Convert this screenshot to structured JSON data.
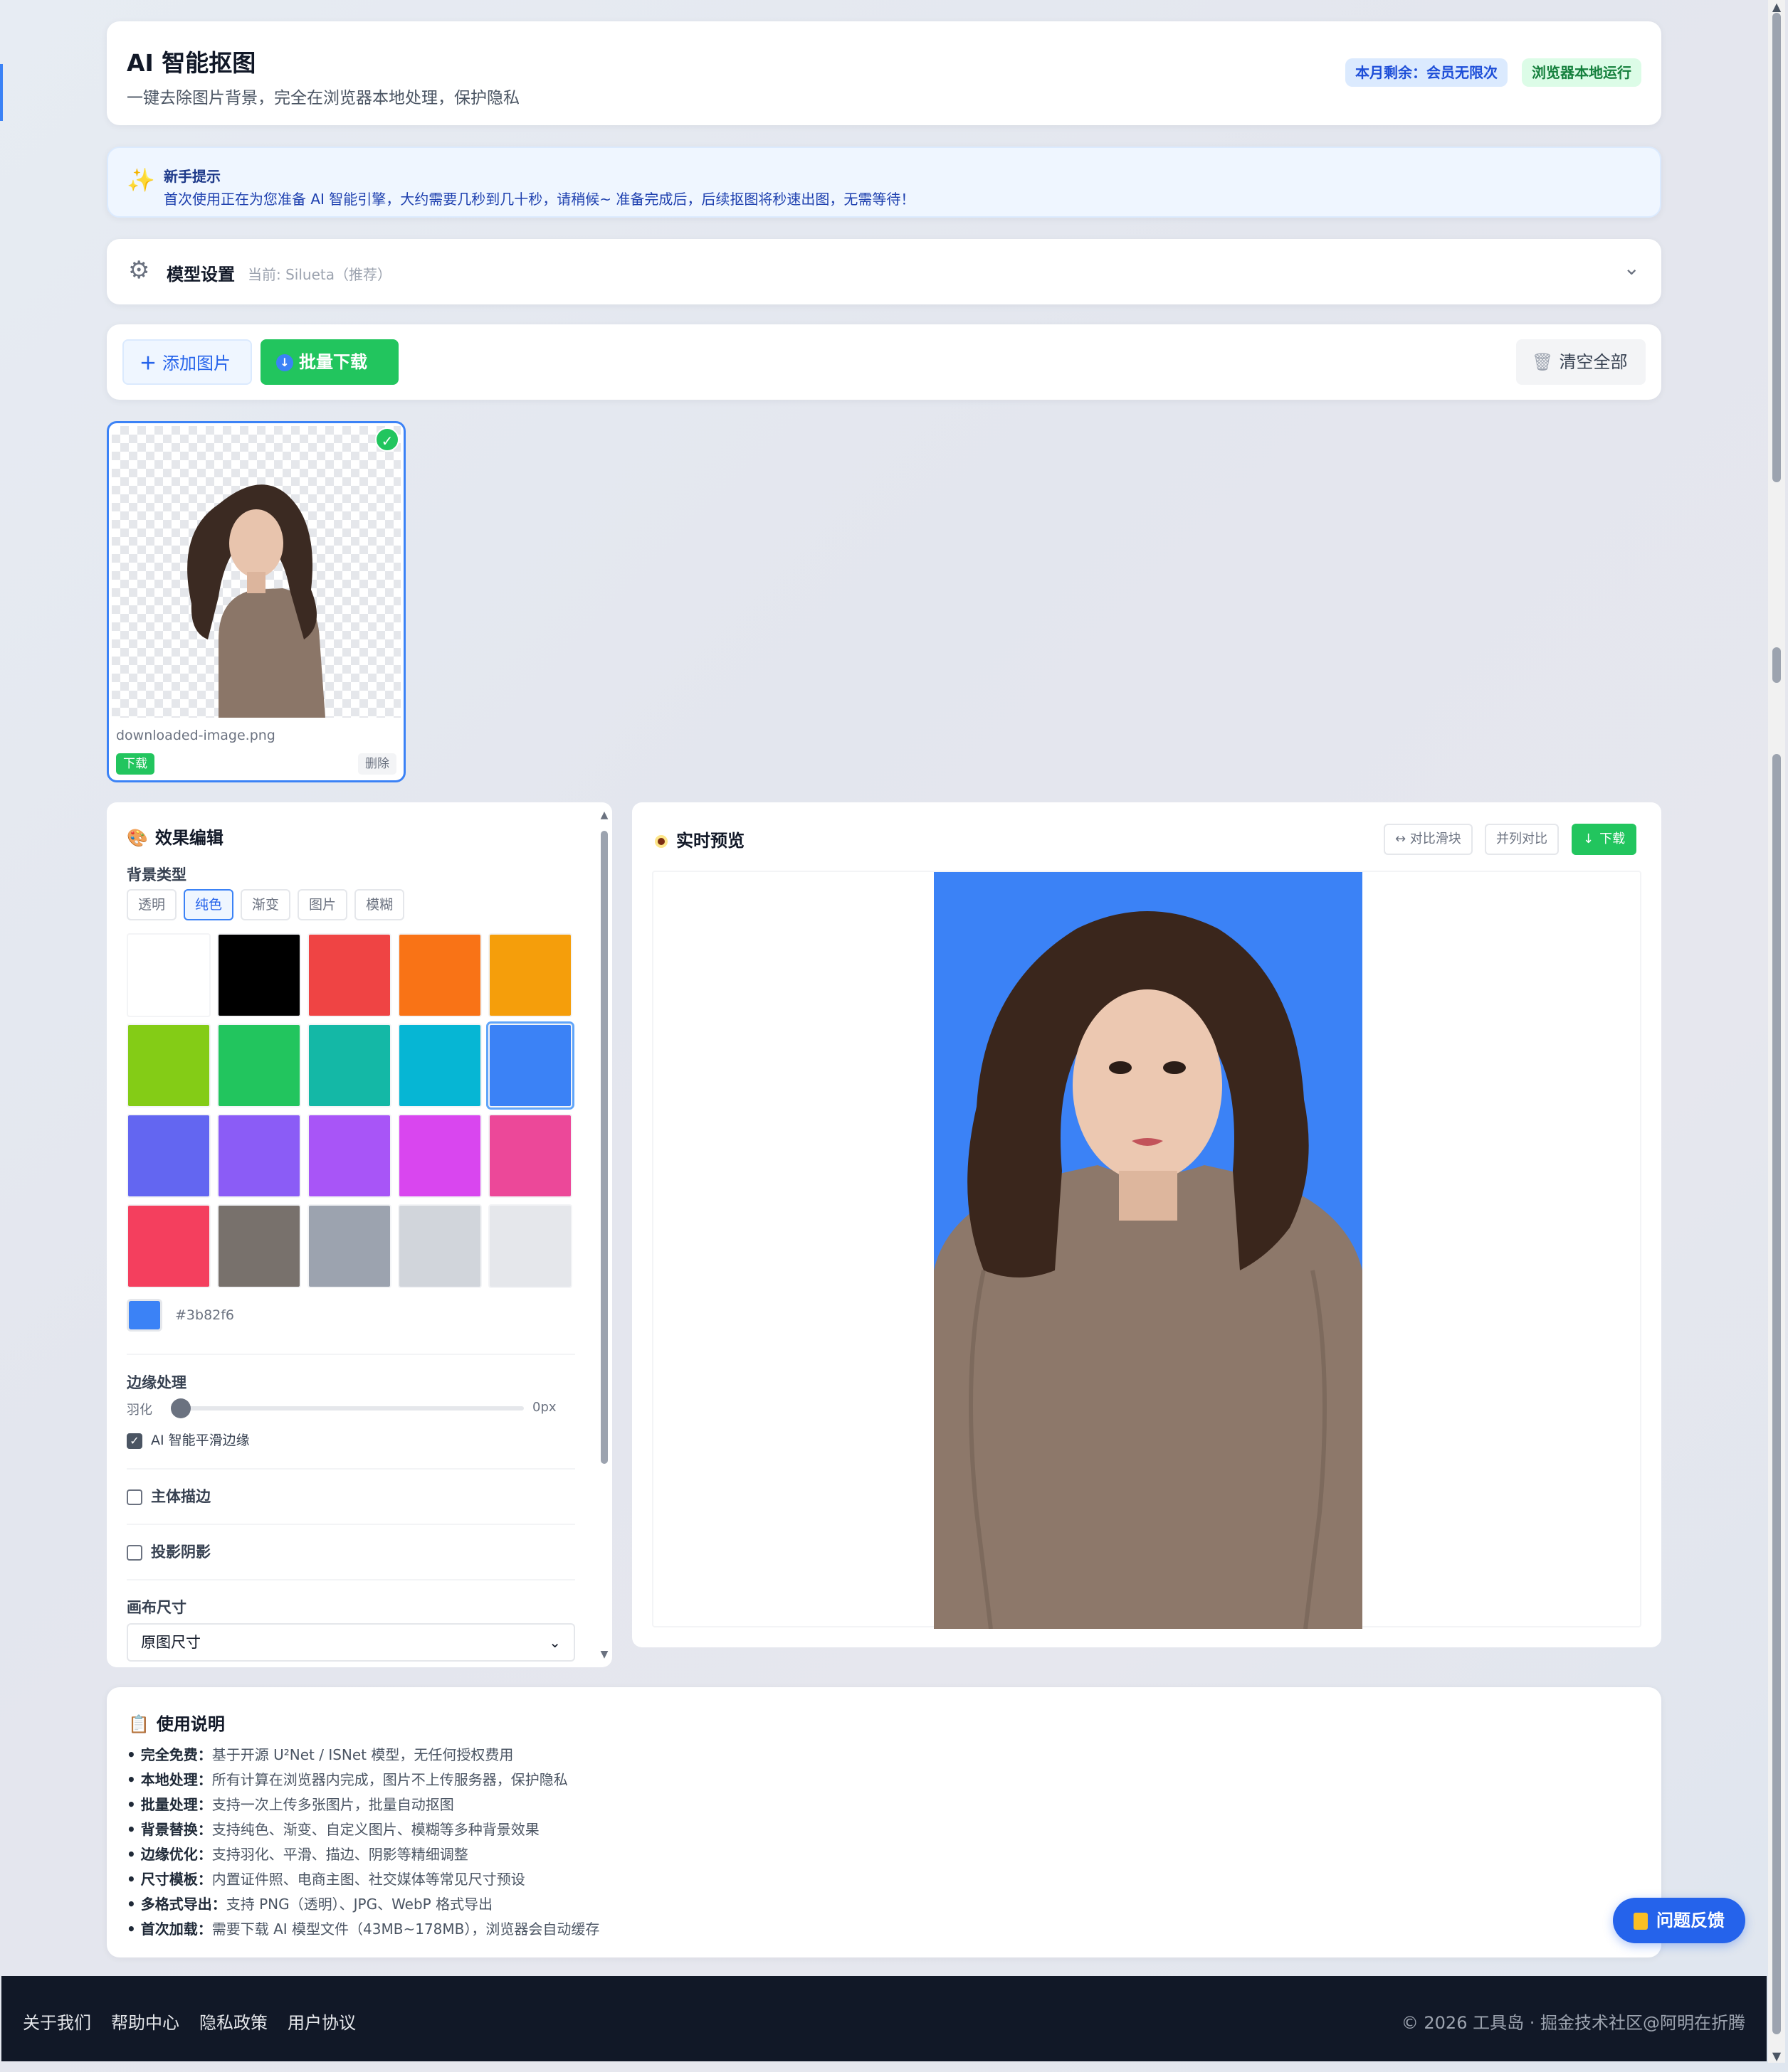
{
  "header": {
    "title": "AI 智能抠图",
    "subtitle": "一键去除图片背景，完全在浏览器本地处理，保护隐私",
    "badge_quota": "本月剩余：会员无限次",
    "badge_local": "浏览器本地运行"
  },
  "tip": {
    "title": "新手提示",
    "text": "首次使用正在为您准备 AI 智能引擎，大约需要几秒到几十秒，请稍候~ 准备完成后，后续抠图将秒速出图，无需等待！"
  },
  "model": {
    "title": "模型设置",
    "current": "当前: Silueta（推荐）"
  },
  "toolbar": {
    "add": "添加图片",
    "batch_download": "批量下载",
    "clear": "清空全部"
  },
  "thumbnail": {
    "filename": "downloaded-image.png",
    "download": "下载",
    "delete": "删除"
  },
  "editor": {
    "title": "效果编辑",
    "bg_type_label": "背景类型",
    "bg_tabs": [
      "透明",
      "纯色",
      "渐变",
      "图片",
      "模糊"
    ],
    "active_tab": 1,
    "swatches": [
      "#ffffff",
      "#000000",
      "#ef4444",
      "#f97316",
      "#f59e0b",
      "#84cc16",
      "#22c55e",
      "#14b8a6",
      "#06b6d4",
      "#3b82f6",
      "#6366f1",
      "#8b5cf6",
      "#a855f7",
      "#d946ef",
      "#ec4899",
      "#f43f5e",
      "#78716c",
      "#9ca3af",
      "#d1d5db",
      "#e5e7eb"
    ],
    "selected_swatch": 9,
    "current_color": "#3b82f6",
    "current_hex": "#3b82f6",
    "edge_label": "边缘处理",
    "feather_label": "羽化",
    "feather_value": "0px",
    "smooth_label": "AI 智能平滑边缘",
    "smooth_checked": true,
    "outline_label": "主体描边",
    "shadow_label": "投影阴影",
    "canvas_label": "画布尺寸",
    "canvas_value": "原图尺寸"
  },
  "preview": {
    "title": "实时预览",
    "compare": "↔ 对比滑块",
    "side_by_side": "并列对比",
    "download": "下载",
    "bg_color": "#3b82f6"
  },
  "usage": {
    "title": "使用说明",
    "items": [
      {
        "k": "完全免费",
        "v": "基于开源 U²Net / ISNet 模型，无任何授权费用"
      },
      {
        "k": "本地处理",
        "v": "所有计算在浏览器内完成，图片不上传服务器，保护隐私"
      },
      {
        "k": "批量处理",
        "v": "支持一次上传多张图片，批量自动抠图"
      },
      {
        "k": "背景替换",
        "v": "支持纯色、渐变、自定义图片、模糊等多种背景效果"
      },
      {
        "k": "边缘优化",
        "v": "支持羽化、平滑、描边、阴影等精细调整"
      },
      {
        "k": "尺寸模板",
        "v": "内置证件照、电商主图、社交媒体等常见尺寸预设"
      },
      {
        "k": "多格式导出",
        "v": "支持 PNG（透明）、JPG、WebP 格式导出"
      },
      {
        "k": "首次加载",
        "v": "需要下载 AI 模型文件（43MB~178MB），浏览器会自动缓存"
      }
    ]
  },
  "feedback": "问题反馈",
  "footer": {
    "links": [
      "关于我们",
      "帮助中心",
      "隐私政策",
      "用户协议"
    ],
    "copyright": "© 2026 工具岛 · 掘金技术社区@阿明在折腾"
  }
}
